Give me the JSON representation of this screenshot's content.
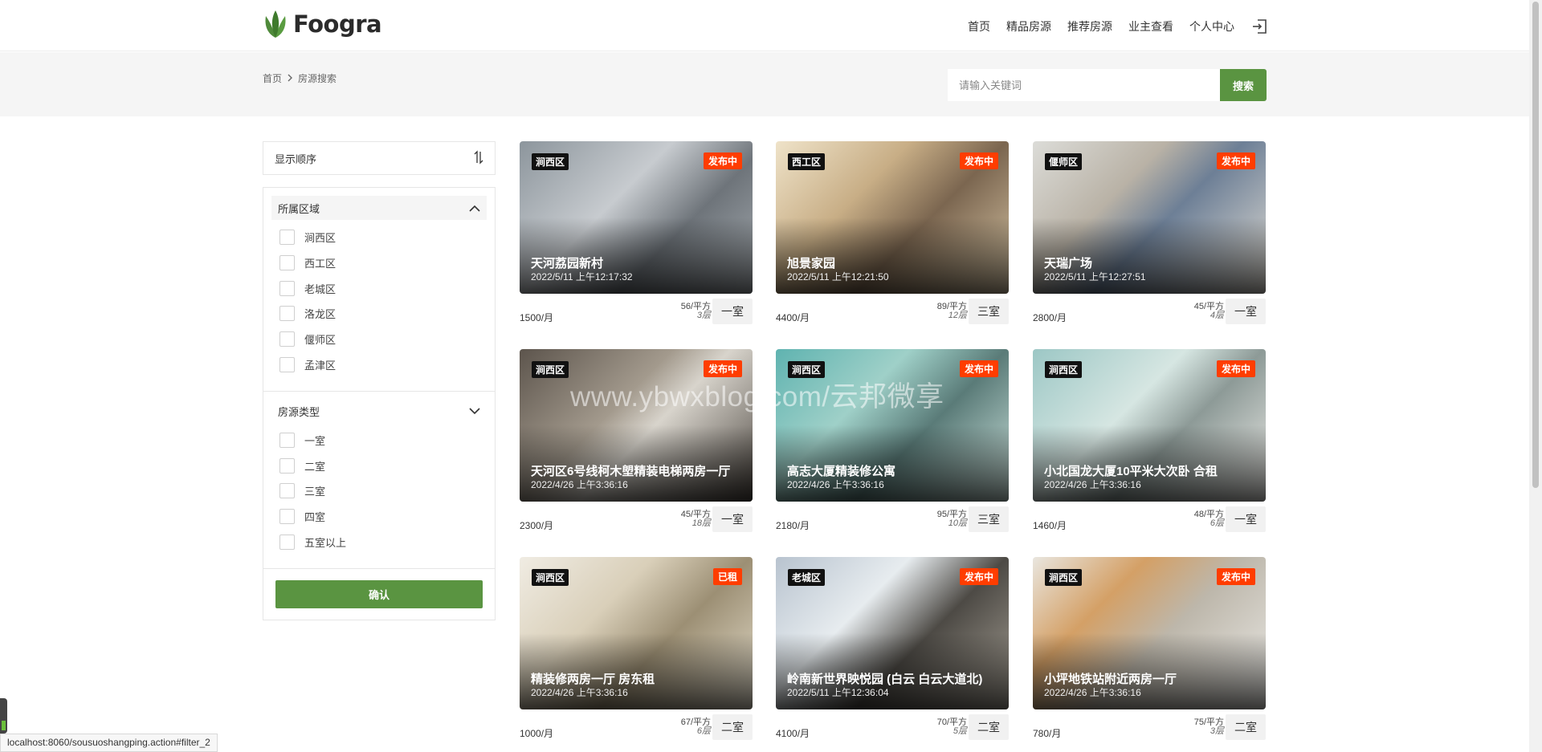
{
  "header": {
    "logo_text": "Foogra",
    "nav": [
      "首页",
      "精品房源",
      "推荐房源",
      "业主查看",
      "个人中心"
    ]
  },
  "breadcrumb": {
    "home": "首页",
    "current": "房源搜索"
  },
  "search": {
    "placeholder": "请输入关键词",
    "button": "搜索"
  },
  "sidebar": {
    "sort_label": "显示顺序",
    "region_title": "所属区域",
    "regions": [
      "涧西区",
      "西工区",
      "老城区",
      "洛龙区",
      "偃师区",
      "孟津区"
    ],
    "type_title": "房源类型",
    "types": [
      "一室",
      "二室",
      "三室",
      "四室",
      "五室以上"
    ],
    "confirm": "确认"
  },
  "listings": [
    {
      "area": "涧西区",
      "status": "发布中",
      "title": "天河荔园新村",
      "date": "2022/5/11 上午12:17:32",
      "price": "1500/月",
      "size": "56/平方",
      "floor": "3层",
      "rooms": "一室"
    },
    {
      "area": "西工区",
      "status": "发布中",
      "title": "旭景家园",
      "date": "2022/5/11 上午12:21:50",
      "price": "4400/月",
      "size": "89/平方",
      "floor": "12层",
      "rooms": "三室"
    },
    {
      "area": "偃师区",
      "status": "发布中",
      "title": "天瑞广场",
      "date": "2022/5/11 上午12:27:51",
      "price": "2800/月",
      "size": "45/平方",
      "floor": "4层",
      "rooms": "一室"
    },
    {
      "area": "涧西区",
      "status": "发布中",
      "title": "天河区6号线柯木塱精装电梯两房一厅",
      "date": "2022/4/26 上午3:36:16",
      "price": "2300/月",
      "size": "45/平方",
      "floor": "18层",
      "rooms": "一室"
    },
    {
      "area": "涧西区",
      "status": "发布中",
      "title": "高志大厦精装修公寓",
      "date": "2022/4/26 上午3:36:16",
      "price": "2180/月",
      "size": "95/平方",
      "floor": "10层",
      "rooms": "三室"
    },
    {
      "area": "涧西区",
      "status": "发布中",
      "title": "小北国龙大厦10平米大次卧 合租",
      "date": "2022/4/26 上午3:36:16",
      "price": "1460/月",
      "size": "48/平方",
      "floor": "6层",
      "rooms": "一室"
    },
    {
      "area": "涧西区",
      "status": "已租",
      "title": "精装修两房一厅 房东租",
      "date": "2022/4/26 上午3:36:16",
      "price": "1000/月",
      "size": "67/平方",
      "floor": "6层",
      "rooms": "二室"
    },
    {
      "area": "老城区",
      "status": "发布中",
      "title": "岭南新世界映悦园 (白云 白云大道北)",
      "date": "2022/5/11 上午12:36:04",
      "price": "4100/月",
      "size": "70/平方",
      "floor": "5层",
      "rooms": "二室"
    },
    {
      "area": "涧西区",
      "status": "发布中",
      "title": "小坪地铁站附近两房一厅",
      "date": "2022/4/26 上午3:36:16",
      "price": "780/月",
      "size": "75/平方",
      "floor": "3层",
      "rooms": "二室"
    }
  ],
  "watermark": "www.ybwxblog.com/云邦微享",
  "status_url": "localhost:8060/sousuoshangping.action#filter_2",
  "colors": {
    "accent": "#5a9441",
    "status_tag": "#ff3d00",
    "area_tag": "#111111"
  }
}
